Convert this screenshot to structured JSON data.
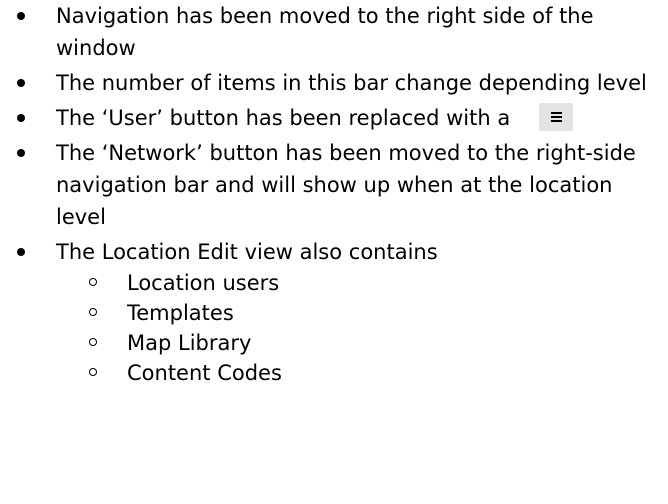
{
  "bullets": [
    {
      "text": "Navigation has been moved to the right side of the window"
    },
    {
      "text": "The number of items in this bar change depending level"
    },
    {
      "text": "The ‘User’ button has been replaced with a",
      "icon": "menu-icon"
    },
    {
      "text": "The ‘Network’ button has been moved to the right-side navigation bar and will show up when at the location level"
    },
    {
      "text": "The Location Edit view also contains"
    }
  ],
  "sub_bullets": [
    "Location users",
    "Templates",
    "Map Library",
    "Content Codes"
  ],
  "colors": {
    "text": "#000000",
    "menu_button_bg": "#e4e4e4"
  }
}
